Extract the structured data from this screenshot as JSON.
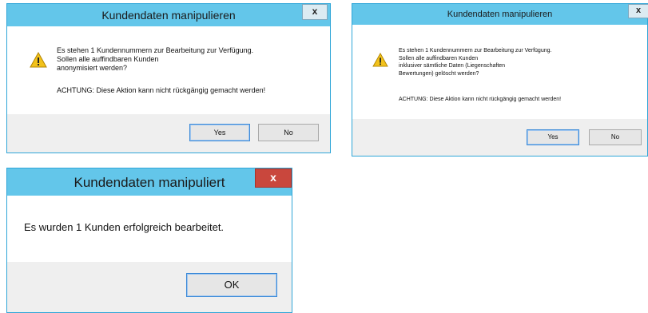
{
  "dialog1": {
    "title": "Kundendaten manipulieren",
    "close_glyph": "x",
    "message": "Es stehen 1 Kundennummern zur Bearbeitung zur Verfügung.\nSollen alle auffindbaren Kunden\nanonymisiert werden?",
    "warning": "ACHTUNG: Diese Aktion kann nicht rückgängig gemacht werden!",
    "yes_label": "Yes",
    "no_label": "No"
  },
  "dialog2": {
    "title": "Kundendaten manipulieren",
    "close_glyph": "x",
    "message": "Es stehen 1 Kundennummern zur Bearbeitung zur Verfügung.\nSollen alle auffindbaren Kunden\ninklusiver sämtliche Daten (Liegenschaften\nBewertungen) gelöscht werden?",
    "warning": "ACHTUNG: Diese Aktion kann nicht rückgängig gemacht werden!",
    "yes_label": "Yes",
    "no_label": "No"
  },
  "dialog3": {
    "title": "Kundendaten manipuliert",
    "close_glyph": "x",
    "message": "Es wurden 1 Kunden erfolgreich bearbeitet.",
    "ok_label": "OK"
  },
  "colors": {
    "titlebar": "#63c6ea",
    "border": "#2fa6d8",
    "close_red": "#c9473d",
    "footer": "#efefef",
    "warning_yellow": "#f2c21b"
  },
  "icons": [
    "warning-icon",
    "close-icon"
  ]
}
